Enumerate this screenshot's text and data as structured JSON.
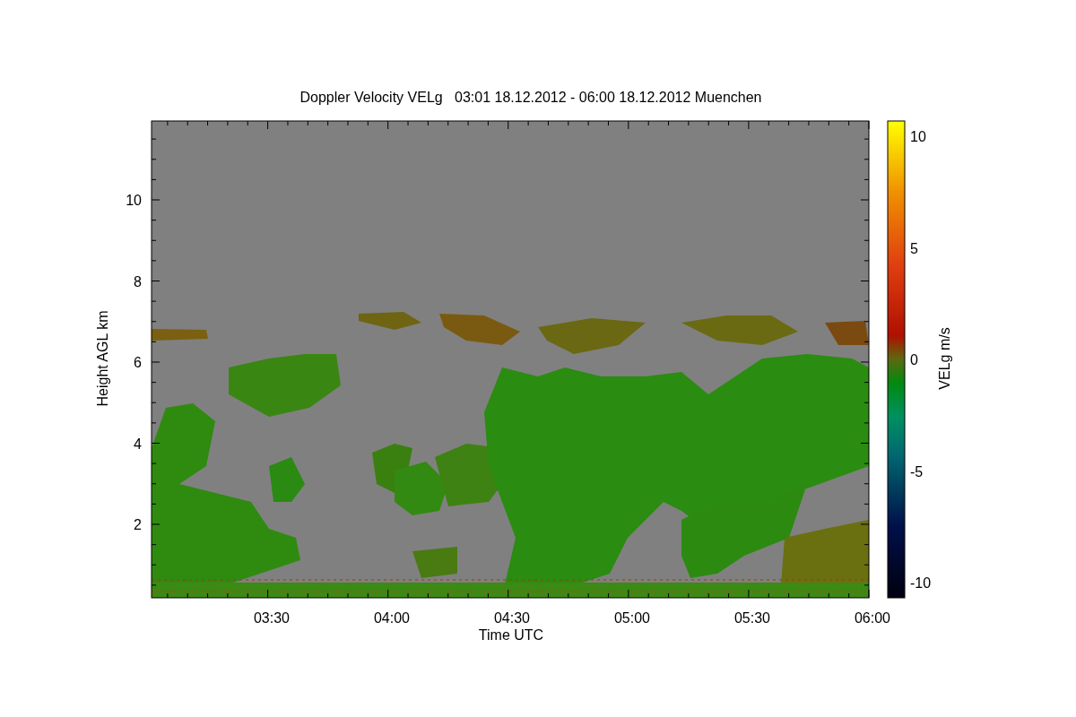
{
  "plot": {
    "title": "Doppler Velocity VELg   03:01 18.12.2012 - 06:00 18.12.2012 Muenchen",
    "xlabel": "Time UTC",
    "ylabel": "Height AGL km",
    "xtick_labels": [
      "03:30",
      "04:00",
      "04:30",
      "05:00",
      "05:30",
      "06:00"
    ],
    "ytick_labels": [
      "10",
      "8",
      "6",
      "4",
      "2"
    ]
  },
  "colorbar": {
    "label": "VELg m/s",
    "tick_labels": [
      "10",
      "5",
      "0",
      "-5",
      "-10"
    ]
  }
}
